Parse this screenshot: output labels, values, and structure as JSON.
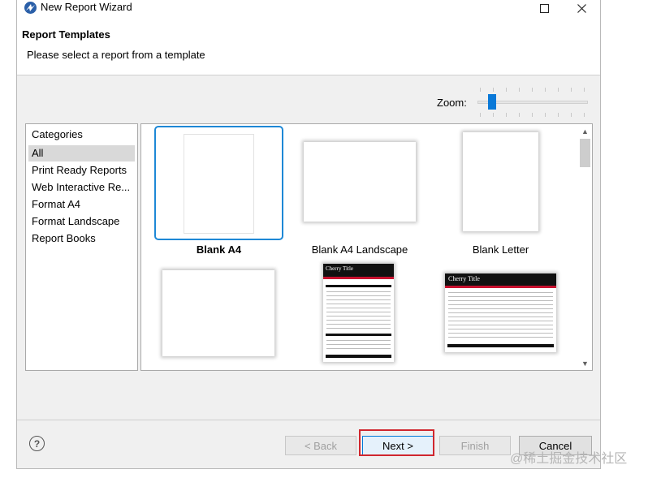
{
  "window": {
    "title": "New Report Wizard"
  },
  "header": {
    "title": "Report Templates",
    "subtitle": "Please select a report from a template"
  },
  "zoom": {
    "label": "Zoom:",
    "value": 0.1
  },
  "categories": {
    "header": "Categories",
    "selected_index": 0,
    "items": [
      "All",
      "Print Ready Reports",
      "Web Interactive Re...",
      "Format A4",
      "Format Landscape",
      "Report Books"
    ]
  },
  "templates": [
    {
      "label": "Blank A4",
      "selected": true
    },
    {
      "label": "Blank A4 Landscape",
      "selected": false
    },
    {
      "label": "Blank Letter",
      "selected": false
    },
    {
      "label": "",
      "selected": false
    },
    {
      "label": "",
      "selected": false,
      "preview_title": "Cherry Title"
    },
    {
      "label": "",
      "selected": false,
      "preview_title": "Cherry Title"
    }
  ],
  "buttons": {
    "back": "< Back",
    "next": "Next >",
    "finish": "Finish",
    "cancel": "Cancel"
  },
  "watermark": "@稀土掘金技术社区",
  "colors": {
    "accent": "#0078d7",
    "selection_border": "#1e88d6",
    "highlight_red": "#d0262e",
    "cherry_red": "#c8102e"
  }
}
